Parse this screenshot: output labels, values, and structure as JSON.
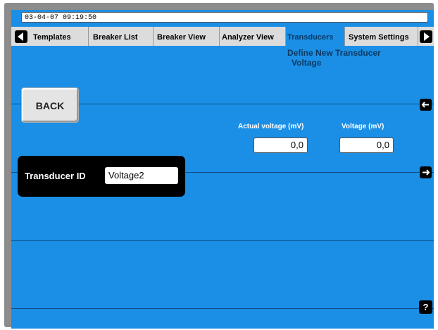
{
  "status": {
    "datetime": "03-04-07 09:19:50"
  },
  "tabs": [
    {
      "label": "Templates"
    },
    {
      "label": "Breaker List"
    },
    {
      "label": "Breaker View"
    },
    {
      "label": "Analyzer View"
    },
    {
      "label": "Transducers",
      "active": true
    },
    {
      "label": "System Settings"
    }
  ],
  "page": {
    "subtitle_line1": "Define New Transducer",
    "subtitle_line2": "Voltage"
  },
  "back_button": {
    "label": "BACK"
  },
  "fields": {
    "actual_voltage_label": "Actual voltage (mV)",
    "actual_voltage_value": "0,0",
    "voltage_label": "Voltage (mV)",
    "voltage_value": "0,0"
  },
  "transducer": {
    "id_label": "Transducer ID",
    "id_value": "Voltage2"
  },
  "help": {
    "label": "?"
  },
  "icons": {
    "tab_prev": "arrow-left-icon",
    "tab_next": "arrow-right-icon",
    "row_left": "arrow-left-icon",
    "row_right": "arrow-right-icon",
    "help": "question-icon"
  },
  "colors": {
    "screen": "#1b8fe6",
    "tabbar": "#dcdcdc",
    "panel": "#000000"
  }
}
